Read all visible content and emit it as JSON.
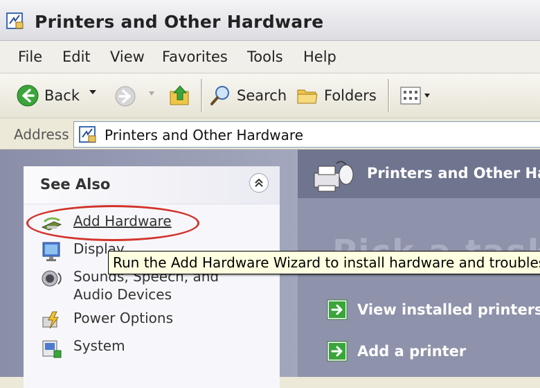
{
  "window": {
    "title": "Printers and Other Hardware",
    "icon": "printers-folder-icon"
  },
  "menu": {
    "items": [
      "File",
      "Edit",
      "View",
      "Favorites",
      "Tools",
      "Help"
    ]
  },
  "toolbar": {
    "back_label": "Back",
    "search_label": "Search",
    "folders_label": "Folders"
  },
  "address": {
    "label": "Address",
    "value": "Printers and Other Hardware"
  },
  "see_also": {
    "title": "See Also",
    "links": [
      {
        "label": "Add Hardware",
        "icon": "add-hardware-icon"
      },
      {
        "label": "Display",
        "icon": "display-icon"
      },
      {
        "label": "Sounds, Speech, and",
        "label2": "Audio Devices",
        "icon": "sounds-icon"
      },
      {
        "label": "Power Options",
        "icon": "power-options-icon"
      },
      {
        "label": "System",
        "icon": "system-icon"
      }
    ]
  },
  "content": {
    "banner_title": "Printers and Other Ha",
    "background_heading": "Pick a task",
    "tasks": [
      {
        "label": "View installed printers o",
        "icon": "green-arrow-icon"
      },
      {
        "label": "Add a printer",
        "icon": "green-arrow-icon"
      }
    ]
  },
  "tooltip": {
    "text": "Run the Add Hardware Wizard to install hardware and troublesho"
  },
  "colors": {
    "left_pane": "#8a8ea8",
    "banner": "#6f748f",
    "highlight_ring": "#d2342b",
    "task_arrow": "#3aa53a",
    "tooltip_bg": "#ffffe1"
  }
}
